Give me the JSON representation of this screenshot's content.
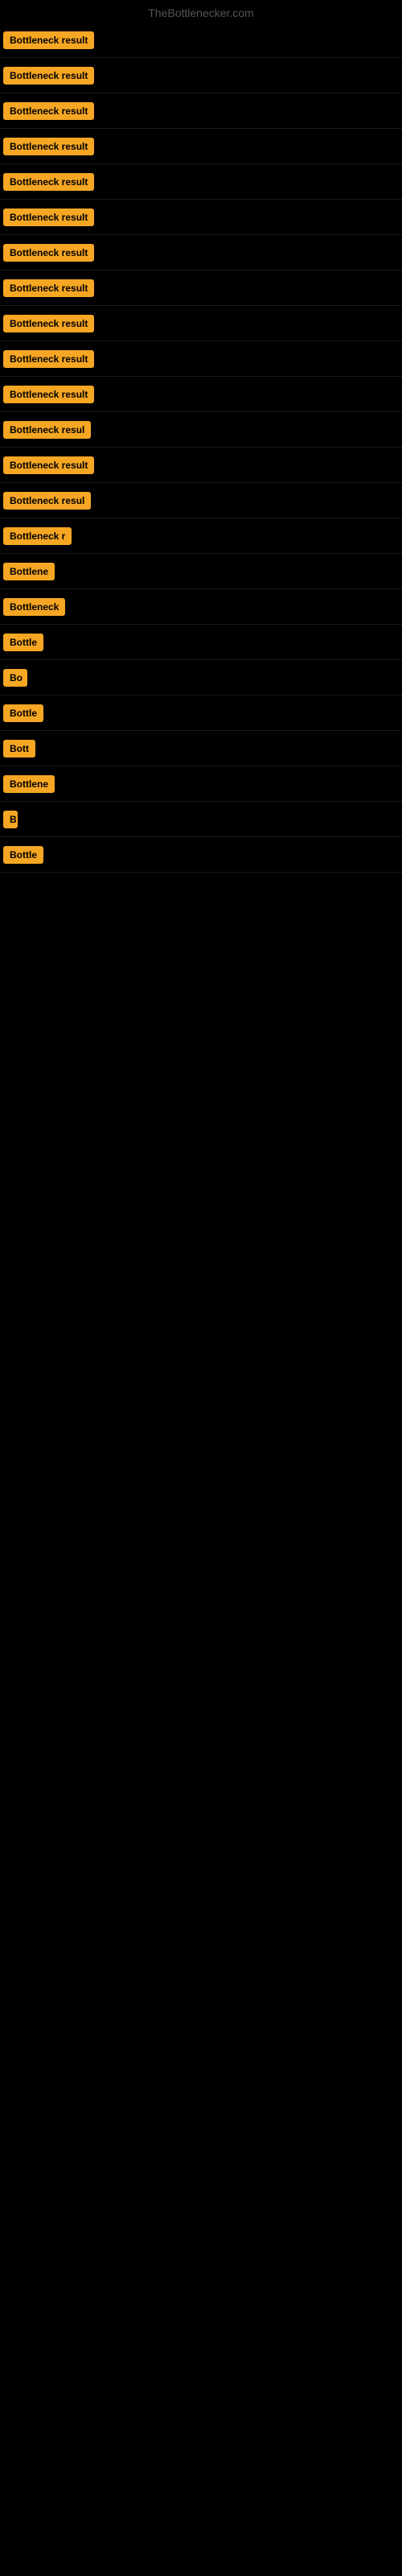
{
  "header": {
    "title": "TheBottlenecker.com"
  },
  "rows": [
    {
      "id": 1,
      "badge_text": "Bottleneck result",
      "badge_width": 120
    },
    {
      "id": 2,
      "badge_text": "Bottleneck result",
      "badge_width": 120
    },
    {
      "id": 3,
      "badge_text": "Bottleneck result",
      "badge_width": 120
    },
    {
      "id": 4,
      "badge_text": "Bottleneck result",
      "badge_width": 120
    },
    {
      "id": 5,
      "badge_text": "Bottleneck result",
      "badge_width": 120
    },
    {
      "id": 6,
      "badge_text": "Bottleneck result",
      "badge_width": 120
    },
    {
      "id": 7,
      "badge_text": "Bottleneck result",
      "badge_width": 120
    },
    {
      "id": 8,
      "badge_text": "Bottleneck result",
      "badge_width": 120
    },
    {
      "id": 9,
      "badge_text": "Bottleneck result",
      "badge_width": 120
    },
    {
      "id": 10,
      "badge_text": "Bottleneck result",
      "badge_width": 120
    },
    {
      "id": 11,
      "badge_text": "Bottleneck result",
      "badge_width": 120
    },
    {
      "id": 12,
      "badge_text": "Bottleneck resul",
      "badge_width": 110
    },
    {
      "id": 13,
      "badge_text": "Bottleneck result",
      "badge_width": 120
    },
    {
      "id": 14,
      "badge_text": "Bottleneck resul",
      "badge_width": 110
    },
    {
      "id": 15,
      "badge_text": "Bottleneck r",
      "badge_width": 90
    },
    {
      "id": 16,
      "badge_text": "Bottlene",
      "badge_width": 70
    },
    {
      "id": 17,
      "badge_text": "Bottleneck",
      "badge_width": 80
    },
    {
      "id": 18,
      "badge_text": "Bottle",
      "badge_width": 55
    },
    {
      "id": 19,
      "badge_text": "Bo",
      "badge_width": 30
    },
    {
      "id": 20,
      "badge_text": "Bottle",
      "badge_width": 55
    },
    {
      "id": 21,
      "badge_text": "Bott",
      "badge_width": 42
    },
    {
      "id": 22,
      "badge_text": "Bottlene",
      "badge_width": 70
    },
    {
      "id": 23,
      "badge_text": "B",
      "badge_width": 18
    },
    {
      "id": 24,
      "badge_text": "Bottle",
      "badge_width": 55
    }
  ]
}
